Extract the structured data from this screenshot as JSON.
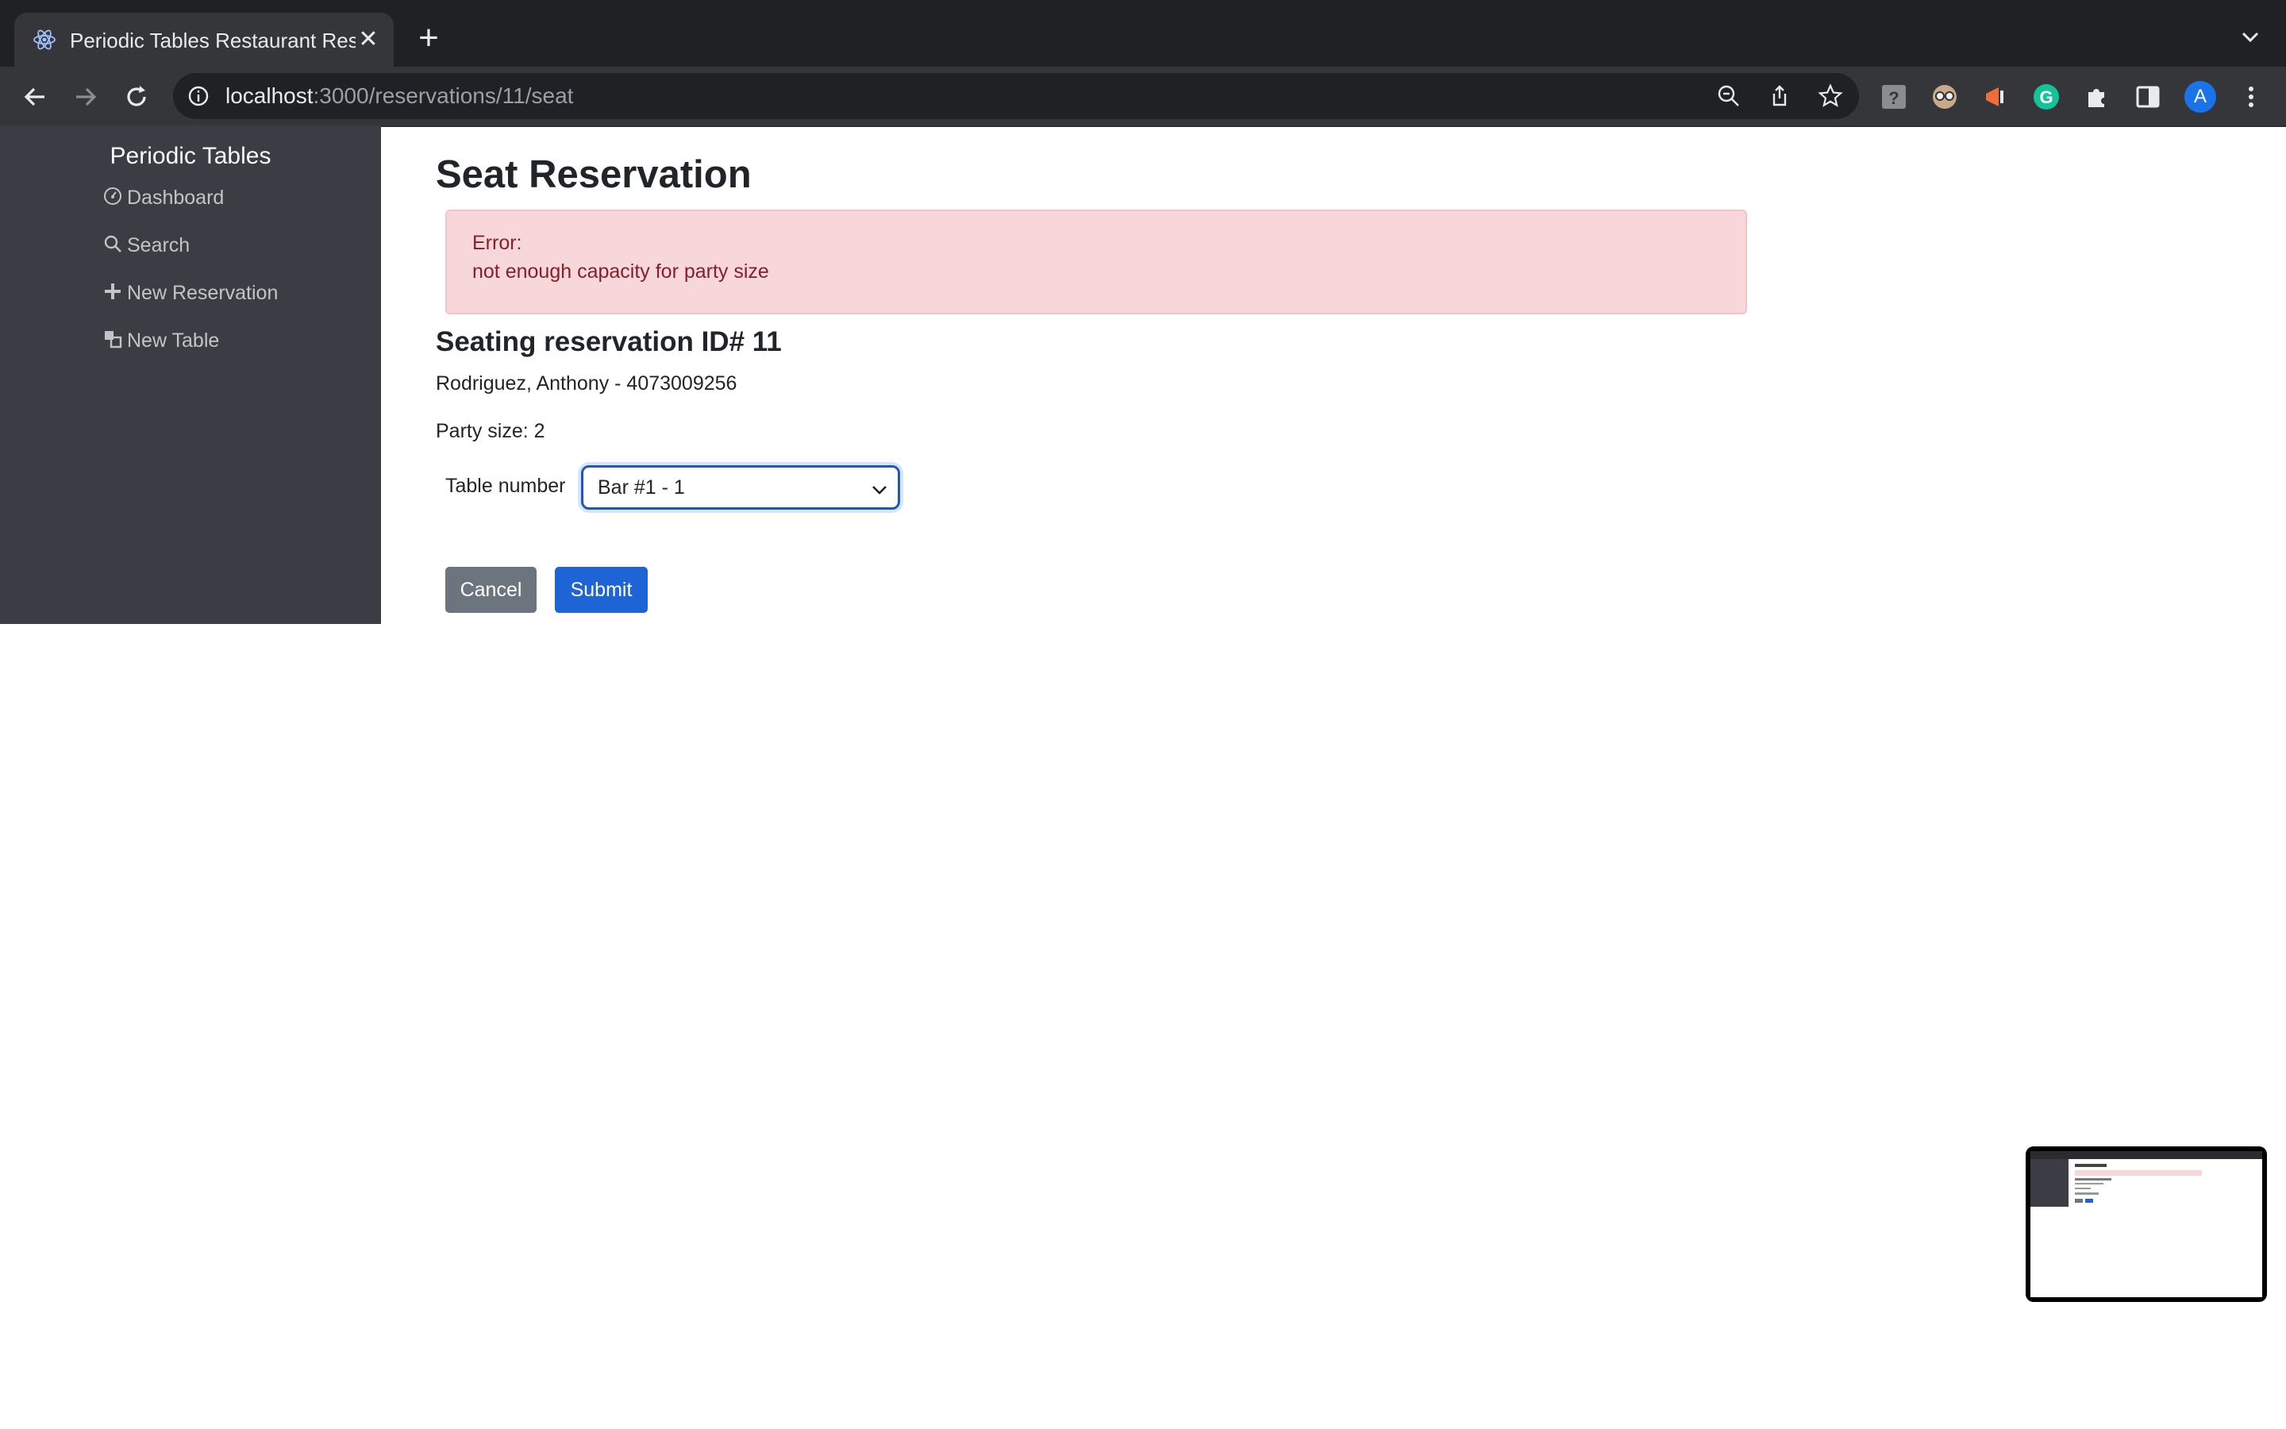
{
  "browser": {
    "tab_title": "Periodic Tables Restaurant Res",
    "url_host": "localhost",
    "url_path": ":3000/reservations/11/seat",
    "profile_initial": "A"
  },
  "sidebar": {
    "brand": "Periodic Tables",
    "items": [
      {
        "label": "Dashboard",
        "icon": "dashboard-icon"
      },
      {
        "label": "Search",
        "icon": "search-icon"
      },
      {
        "label": "New Reservation",
        "icon": "plus-icon"
      },
      {
        "label": "New Table",
        "icon": "layers-icon"
      }
    ]
  },
  "main": {
    "title": "Seat Reservation",
    "error": {
      "heading": "Error:",
      "message": "not enough capacity for party size"
    },
    "section_title": "Seating reservation ID# 11",
    "guest": "Rodriguez, Anthony - 4073009256",
    "party_size": "Party size: 2",
    "table_label": "Table number",
    "table_selected": "Bar #1 - 1",
    "cancel_label": "Cancel",
    "submit_label": "Submit"
  },
  "colors": {
    "sidebar_bg": "#3c3d44",
    "alert_bg": "#f8d7da",
    "alert_text": "#842029",
    "primary": "#1f64d6",
    "secondary": "#6c757d"
  }
}
